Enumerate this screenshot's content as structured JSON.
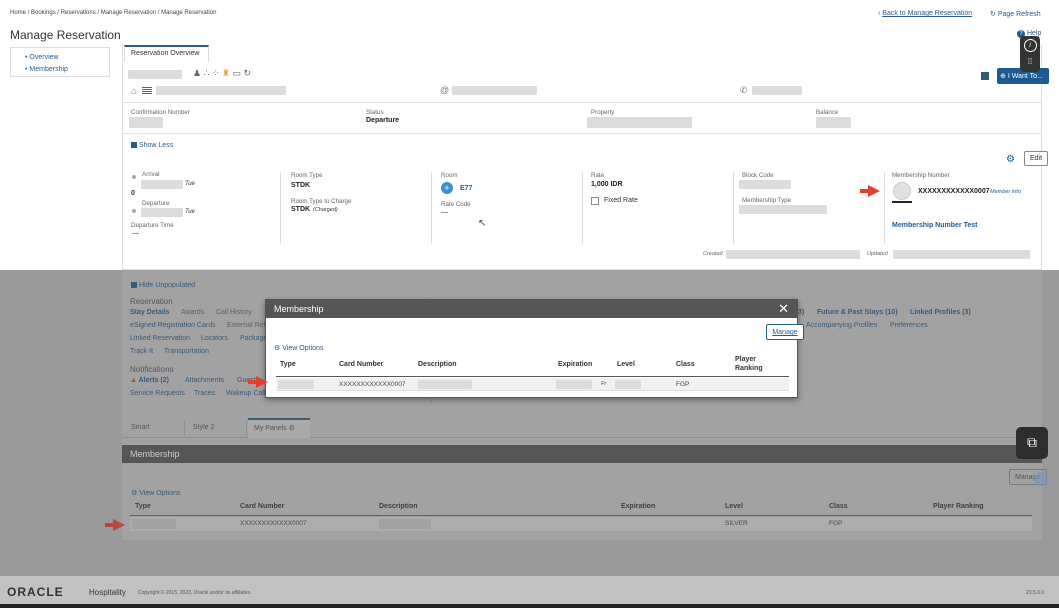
{
  "breadcrumb": "Home / Bookings / Reservations / Manage Reservation / Manage Reservation",
  "header_links": {
    "back": "Back to Manage Reservation",
    "refresh": "Page Refresh",
    "help": "Help"
  },
  "page_title": "Manage Reservation",
  "side_nav": [
    "Overview",
    "Membership"
  ],
  "tab_overview": "Reservation Overview",
  "i_want_to": "I Want To...",
  "summary": {
    "confirmation_label": "Confirmation Number",
    "status_label": "Status",
    "status_value": "Departure",
    "property_label": "Property",
    "balance_label": "Balance"
  },
  "show_less": "Show Less",
  "edit": "Edit",
  "details": {
    "arrival_label": "Arrival",
    "arrival_day": "Tue",
    "nights": "0",
    "departure_label": "Departure",
    "departure_day": "Tue",
    "departure_time_label": "Departure Time",
    "departure_time_value": "—",
    "room_type_label": "Room Type",
    "room_type_value": "STDK",
    "rtc_label": "Room Type to Charge",
    "rtc_value": "STDK",
    "rtc_note": "(Charged)",
    "room_label": "Room",
    "room_value": "E77",
    "rate_code_label": "Rate Code",
    "rate_code_value": "—",
    "rate_label": "Rate",
    "rate_value": "1,000 IDR",
    "fixed_rate": "Fixed Rate",
    "block_code_label": "Block Code",
    "membership_type_label": "Membership Type",
    "membership_number_label": "Membership Number",
    "membership_number_value": "XXXXXXXXXXXX0007",
    "member_info": "Member Info",
    "membership_test": "Membership Number Test",
    "created": "Created",
    "updated": "Updated"
  },
  "lower": {
    "hide_unpopulated": "Hide Unpopulated",
    "reservation": "Reservation",
    "stay_details": "Stay Details",
    "awards": "Awards",
    "call_history": "Call History",
    "esigned": "eSigned Registration Cards",
    "external": "External Ref",
    "linked_reservation": "Linked Reservation",
    "locators": "Locators",
    "package": "Package",
    "track_it": "Track It",
    "transportation": "Transportation",
    "notifications": "Notifications",
    "alerts": "Alerts (2)",
    "attachments": "Attachments",
    "guest": "Guest",
    "service_requests": "Service Requests",
    "traces": "Traces",
    "wakeup": "Wakeup Call",
    "future_past": "Future & Past Stays (10)",
    "linked_profiles": "Linked Profiles (3)",
    "accompanying": "Accompanying Profiles",
    "preferences": "Preferences",
    "count3": "3)"
  },
  "panel_tabs": [
    "Smart",
    "Style 2",
    "My Panels"
  ],
  "membership_panel": {
    "title": "Membership",
    "view_options": "View Options",
    "manage": "Manage",
    "headers": [
      "Type",
      "Card Number",
      "Description",
      "Expiration",
      "Level",
      "Class",
      "Player Ranking"
    ],
    "row": {
      "card": "XXXXXXXXXXXX0007",
      "level": "SILVER",
      "class": "FGP"
    }
  },
  "modal": {
    "title": "Membership",
    "manage": "Manage",
    "view_options": "View Options",
    "headers": [
      "Type",
      "Card Number",
      "Description",
      "Expiration",
      "Level",
      "Class",
      "Player Ranking"
    ],
    "row": {
      "card": "XXXXXXXXXXXX0007",
      "exp_day": "Fr",
      "class": "FGP"
    }
  },
  "footer": {
    "logo": "ORACLE",
    "hospitality": "Hospitality",
    "copyright": "Copyright © 2015, 2023, Oracle and/or its affiliates.",
    "version": "23.5.0.0"
  }
}
